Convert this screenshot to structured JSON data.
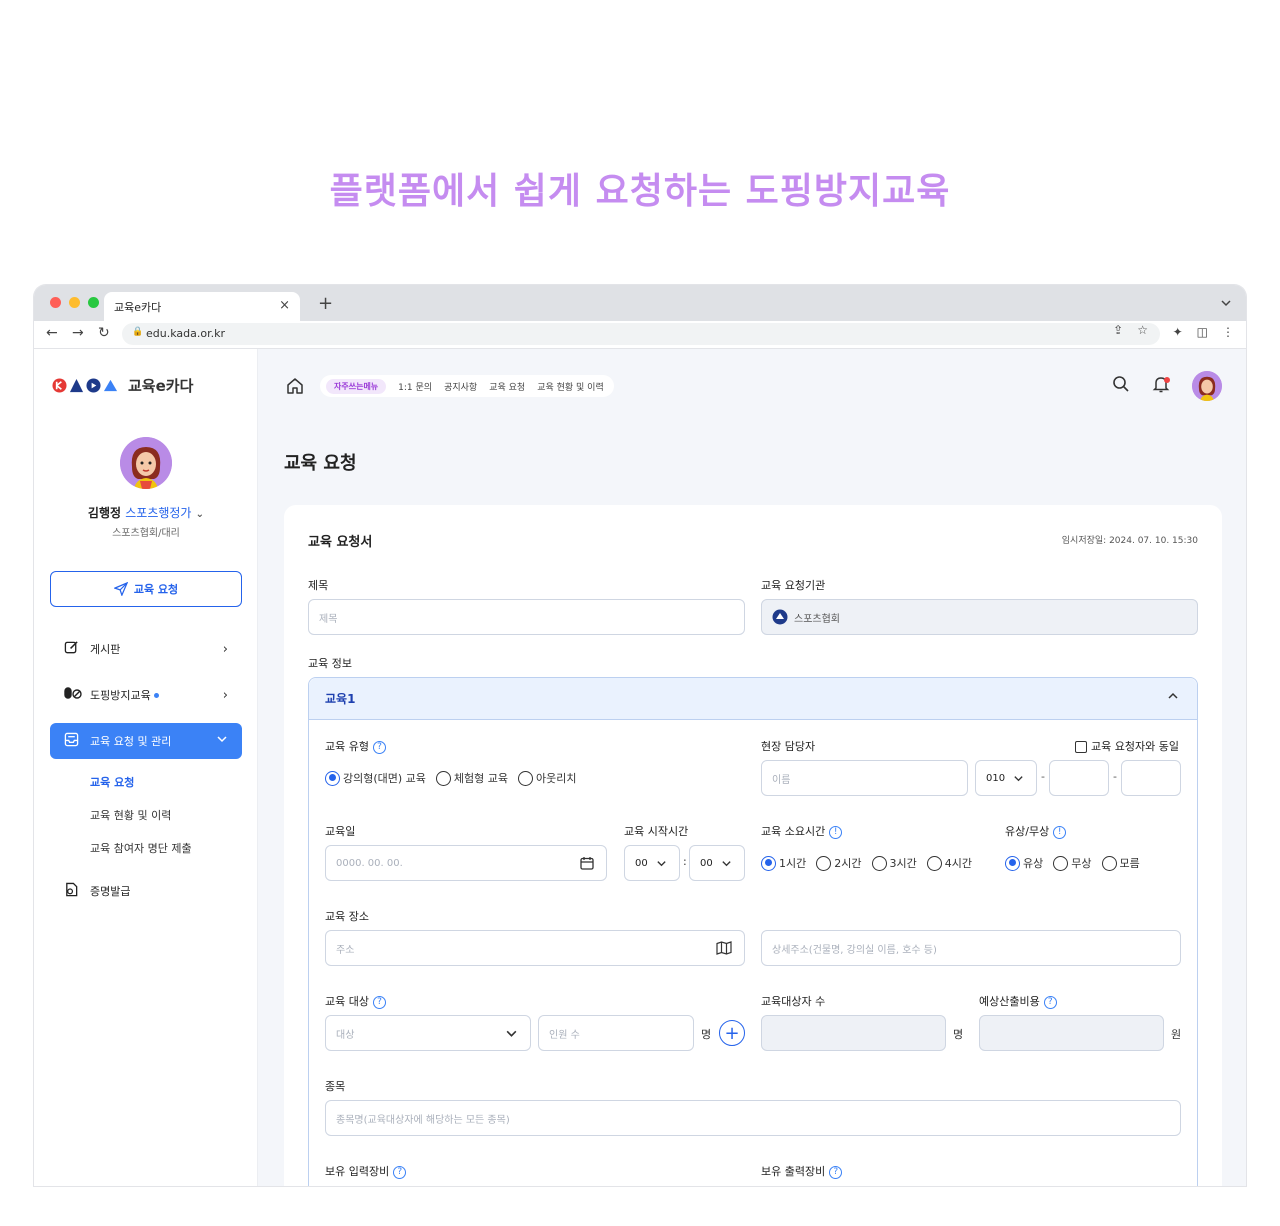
{
  "hero": {
    "title": "플랫폼에서 쉽게 요청하는 도핑방지교육"
  },
  "browser": {
    "tab_title": "교육e카다",
    "tab_close": "×",
    "new_tab": "+",
    "url": "edu.kada.or.kr",
    "traffic_colors": [
      "#ff5f57",
      "#febc2e",
      "#28c840"
    ]
  },
  "sidebar": {
    "logo_text": "교육e카다",
    "user_name": "김행정",
    "user_role": "스포츠행정가",
    "user_org": "스포츠협회/대리",
    "request_button": "교육 요청",
    "menu": [
      {
        "label": "게시판",
        "icon": "edit-icon"
      },
      {
        "label": "도핑방지교육",
        "icon": "pill-icon"
      },
      {
        "label": "교육 요청 및 관리",
        "icon": "inbox-icon"
      },
      {
        "label": "증명발급",
        "icon": "certificate-icon"
      }
    ],
    "submenu": [
      "교육 요청",
      "교육 현황 및 이력",
      "교육 참여자 명단 제출"
    ]
  },
  "header": {
    "quick_chip": "자주쓰는메뉴",
    "quick_links": [
      "1:1 문의",
      "공지사항",
      "교육 요청",
      "교육 현황 및 이력"
    ]
  },
  "page": {
    "title": "교육 요청",
    "card_title": "교육 요청서",
    "saved_at": "임시저장일: 2024. 07. 10. 15:30"
  },
  "form": {
    "subject_label": "제목",
    "subject_placeholder": "제목",
    "org_label": "교육 요청기관",
    "org_value": "스포츠협회",
    "info_label": "교육 정보",
    "section_title": "교육1",
    "type_label": "교육 유형",
    "type_options": [
      "강의형(대면) 교육",
      "체험형 교육",
      "아웃리치"
    ],
    "manager_label": "현장 담당자",
    "same_as_requester": "교육 요청자와 동일",
    "name_placeholder": "이름",
    "phone_prefix": "010",
    "date_label": "교육일",
    "date_placeholder": "0000. 00. 00.",
    "start_label": "교육 시작시간",
    "hour": "00",
    "minute": "00",
    "duration_label": "교육 소요시간",
    "duration_options": [
      "1시간",
      "2시간",
      "3시간",
      "4시간"
    ],
    "paid_label": "유상/무상",
    "paid_options": [
      "유상",
      "무상",
      "모름"
    ],
    "place_label": "교육 장소",
    "address_placeholder": "주소",
    "detail_address_placeholder": "상세주소(건물명, 강의실 이름, 호수 등)",
    "target_label": "교육 대상",
    "target_placeholder": "대상",
    "count_placeholder": "인원 수",
    "unit_person": "명",
    "target_count_label": "교육대상자 수",
    "cost_label": "예상산출비용",
    "unit_won": "원",
    "sport_label": "종목",
    "sport_placeholder": "종목명(교육대상자에 해당하는 모든 종목)",
    "input_equipment_label": "보유 입력장비",
    "output_equipment_label": "보유 출력장비"
  },
  "colors": {
    "accent": "#2563eb",
    "hero": "#c58cf0",
    "active_menu": "#3b82f6"
  }
}
